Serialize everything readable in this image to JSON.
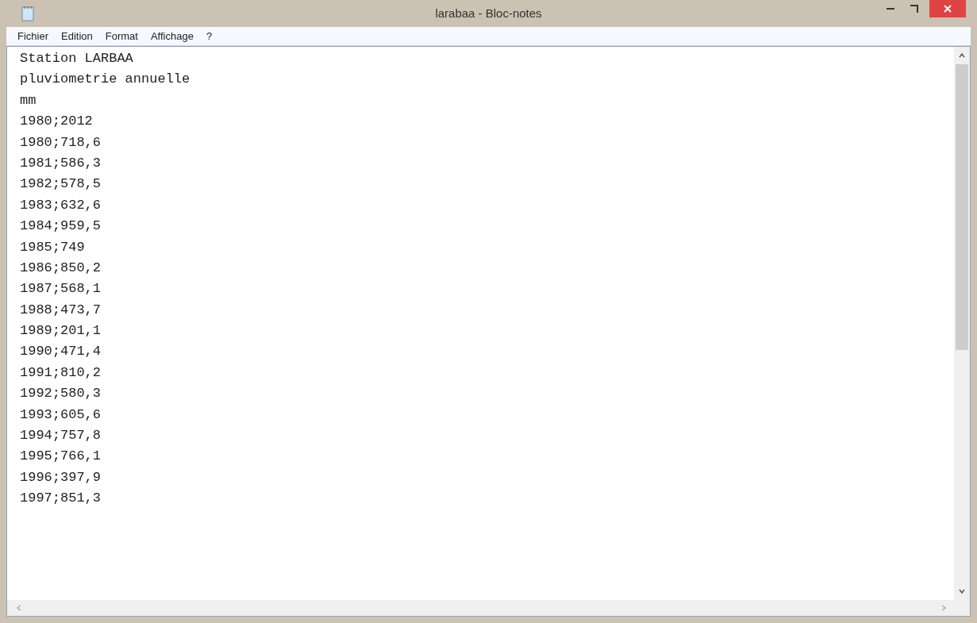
{
  "window": {
    "title": "larabaa - Bloc-notes"
  },
  "menu": [
    "Fichier",
    "Edition",
    "Format",
    "Affichage",
    "?"
  ],
  "lines": [
    "Station LARBAA",
    "pluviometrie annuelle",
    "mm",
    "1980;2012",
    "1980;718,6",
    "1981;586,3",
    "1982;578,5",
    "1983;632,6",
    "1984;959,5",
    "1985;749",
    "1986;850,2",
    "1987;568,1",
    "1988;473,7",
    "1989;201,1",
    "1990;471,4",
    "1991;810,2",
    "1992;580,3",
    "1993;605,6",
    "1994;757,8",
    "1995;766,1",
    "1996;397,9",
    "1997;851,3"
  ]
}
